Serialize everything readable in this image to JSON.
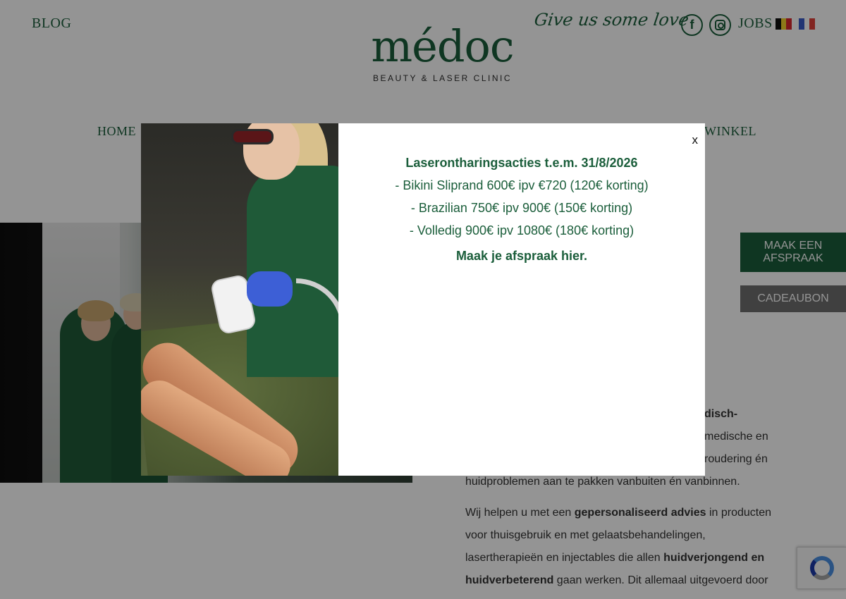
{
  "header": {
    "blog_label": "BLOG",
    "logo_main": "médoc",
    "logo_sub": "BEAUTY & LASER CLINIC",
    "tagline": "Give us some love",
    "social": [
      "facebook-icon",
      "instagram-icon"
    ],
    "jobs_label": "JOBS",
    "languages": [
      "nl-be",
      "fr"
    ]
  },
  "nav": {
    "home_label": "HOME",
    "winkel_label": "WINKEL"
  },
  "sidebar_actions": {
    "appointment_label": "MAAK EEN AFSPRAAK",
    "gift_label": "CADEAUBON"
  },
  "intro": {
    "frag1": "disch-",
    "frag2": "medische en",
    "frag3": "roudering én",
    "line4": "huidproblemen aan te pakken vanbuiten én vanbinnen."
  },
  "paragraph": {
    "p1": "Wij helpen u met een ",
    "p1_bold": "gepersonaliseerd advies",
    "p2": " in producten voor thuisgebruik en met gelaatsbehandelingen, lasertherapieën en injectables die allen ",
    "p2_bold": "huidverjongend en huidverbeterend",
    "p3": " gaan werken. Dit allemaal uitgevoerd door"
  },
  "popup": {
    "title": "Laserontharingsacties t.e.m. 31/8/2026",
    "lines": [
      "- Bikini Sliprand 600€ ipv €720 (120€ korting)",
      "- Brazilian 750€ ipv 900€ (150€ korting)",
      "- Volledig 900€ ipv 1080€ (180€ korting)"
    ],
    "cta": "Maak je afspraak hier.",
    "close_label": "x"
  },
  "colors": {
    "brand_green": "#1b5e3b",
    "gift_gray": "#6e6e6e",
    "overlay": "rgba(0,0,0,0.42)"
  }
}
